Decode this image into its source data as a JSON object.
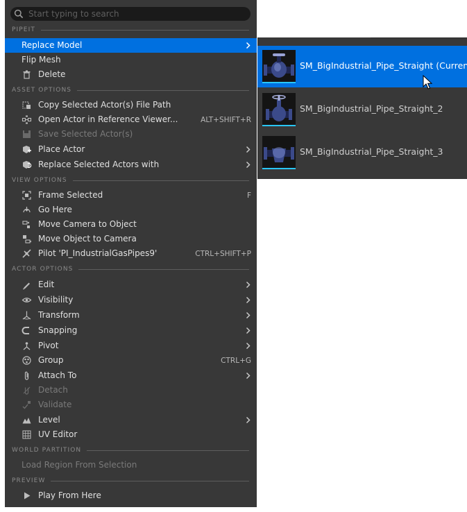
{
  "search": {
    "placeholder": "Start typing to search",
    "value": ""
  },
  "sections": {
    "pipeit": "PIPEIT",
    "asset_options": "ASSET OPTIONS",
    "view_options": "VIEW OPTIONS",
    "actor_options": "ACTOR OPTIONS",
    "world_partition": "WORLD PARTITION",
    "preview": "PREVIEW"
  },
  "pipeit_items": [
    {
      "label": "Replace Model",
      "submenu": true,
      "highlighted": true
    },
    {
      "label": "Flip Mesh"
    },
    {
      "label": "Delete",
      "icon": "trash-icon"
    }
  ],
  "asset_items": [
    {
      "label": "Copy Selected Actor(s) File Path",
      "icon": "copy-path-icon"
    },
    {
      "label": "Open Actor in Reference Viewer...",
      "icon": "reference-viewer-icon",
      "shortcut": "ALT+SHIFT+R"
    },
    {
      "label": "Save Selected Actor(s)",
      "icon": "save-icon",
      "disabled": true
    },
    {
      "label": "Place Actor",
      "icon": "place-actor-icon",
      "submenu": true
    },
    {
      "label": "Replace Selected Actors with",
      "icon": "replace-actor-icon",
      "submenu": true
    }
  ],
  "view_items": [
    {
      "label": "Frame Selected",
      "icon": "frame-icon",
      "shortcut": "F"
    },
    {
      "label": "Go Here",
      "icon": "go-here-icon"
    },
    {
      "label": "Move Camera to Object",
      "icon": "camera-to-object-icon"
    },
    {
      "label": "Move Object to Camera",
      "icon": "object-to-camera-icon"
    },
    {
      "label": "Pilot 'PI_IndustrialGasPipes9'",
      "icon": "pilot-icon",
      "shortcut": "CTRL+SHIFT+P"
    }
  ],
  "actor_items": [
    {
      "label": "Edit",
      "icon": "edit-icon",
      "submenu": true
    },
    {
      "label": "Visibility",
      "icon": "eye-icon",
      "submenu": true
    },
    {
      "label": "Transform",
      "icon": "transform-icon",
      "submenu": true
    },
    {
      "label": "Snapping",
      "icon": "magnet-icon",
      "submenu": true
    },
    {
      "label": "Pivot",
      "icon": "pivot-icon",
      "submenu": true
    },
    {
      "label": "Group",
      "icon": "group-icon",
      "shortcut": "CTRL+G"
    },
    {
      "label": "Attach To",
      "icon": "paperclip-icon",
      "submenu": true
    },
    {
      "label": "Detach",
      "icon": "detach-icon",
      "disabled": true
    },
    {
      "label": "Validate",
      "icon": "validate-icon",
      "disabled": true
    },
    {
      "label": "Level",
      "icon": "level-icon",
      "submenu": true
    },
    {
      "label": "UV Editor",
      "icon": "uv-grid-icon"
    }
  ],
  "world_items": [
    {
      "label": "Load Region From Selection",
      "disabled": true
    }
  ],
  "preview_items": [
    {
      "label": "Play From Here",
      "icon": "play-icon"
    }
  ],
  "submenu_items": [
    {
      "label": "SM_BigIndustrial_Pipe_Straight (Current)",
      "highlighted": true
    },
    {
      "label": "SM_BigIndustrial_Pipe_Straight_2"
    },
    {
      "label": "SM_BigIndustrial_Pipe_Straight_3"
    }
  ],
  "colors": {
    "menu_bg": "#383838",
    "highlight": "#0070e0",
    "search_bg": "#1a1a1a",
    "thumb_underline": "#29c7ff"
  }
}
